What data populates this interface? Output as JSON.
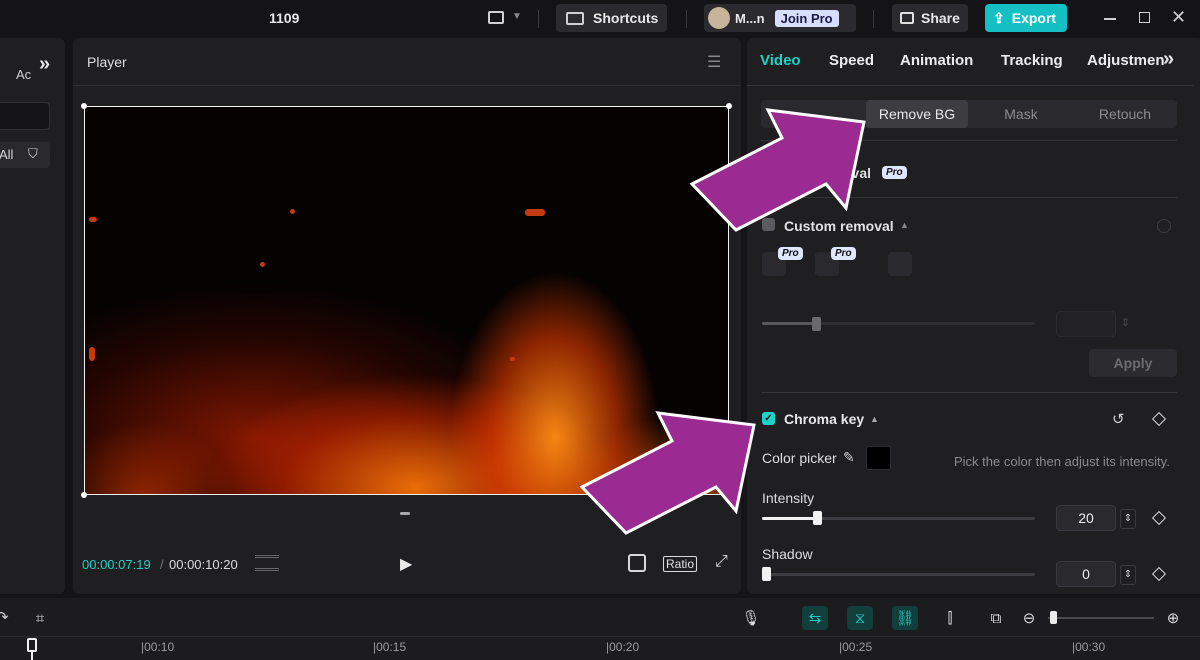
{
  "titlebar": {
    "project_name": "1109",
    "shortcuts_label": "Shortcuts",
    "user_name": "M...n",
    "join_pro_label": "Join Pro",
    "share_label": "Share",
    "export_label": "Export"
  },
  "left": {
    "tab_label": "Ac",
    "all_label": "All"
  },
  "player": {
    "title": "Player",
    "current_time": "00:00:07:19",
    "total_time": "00:00:10:20",
    "ratio_label": "Ratio"
  },
  "inspector": {
    "tabs": [
      "Video",
      "Speed",
      "Animation",
      "Tracking",
      "Adjustmen"
    ],
    "subtabs": [
      "Remove BG",
      "Mask",
      "Retouch"
    ],
    "auto_removal_label": "oval",
    "pro_badge": "Pro",
    "custom_removal_label": "Custom removal",
    "apply_label": "Apply",
    "chroma_key_label": "Chroma key",
    "color_picker_label": "Color picker",
    "color_picker_hint": "Pick the color then adjust its intensity.",
    "intensity_label": "Intensity",
    "intensity_value": "20",
    "intensity_level": 0.2,
    "shadow_label": "Shadow",
    "shadow_value": "0",
    "shadow_level": 0
  },
  "timeline": {
    "ticks": [
      "|00:10",
      "|00:15",
      "|00:20",
      "|00:25",
      "|00:30"
    ]
  },
  "colors": {
    "accent": "#1fd1c6",
    "arrow": "#9b2b93",
    "export_bg": "#14c0c3"
  }
}
